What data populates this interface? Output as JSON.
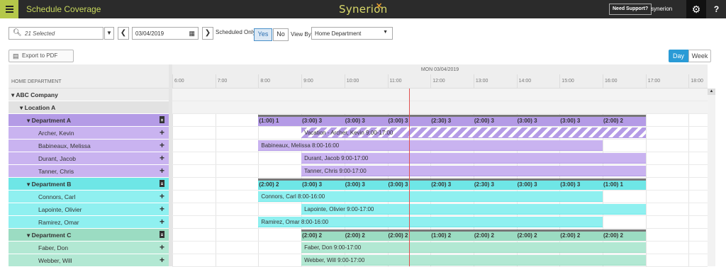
{
  "header": {
    "app_title": "Schedule Coverage",
    "logo": "Synerion",
    "support_label": "Need Support?",
    "user": "synerion",
    "help_label": "?"
  },
  "toolbar": {
    "employee_selection": "21 Selected",
    "date": "03/04/2019",
    "scheduled_only_label": "Scheduled Only",
    "yes_label": "Yes",
    "no_label": "No",
    "view_by_label": "View By",
    "view_by_value": "Home Department",
    "export_label": "Export to PDF",
    "day_label": "Day",
    "week_label": "Week"
  },
  "colors": {
    "dept_a": "#c9b3f0",
    "dept_a_header": "#b49be6",
    "dept_b": "#8ff0f0",
    "dept_b_header": "#6ee6e6",
    "dept_c": "#b2e8d3",
    "dept_c_header": "#9bdcc2",
    "now_line": "#e05050"
  },
  "grid": {
    "column_header": "HOME DEPARTMENT",
    "day_header": "MON 03/04/2019",
    "hours": [
      "6:00",
      "7:00",
      "8:00",
      "9:00",
      "10:00",
      "11:00",
      "12:00",
      "13:00",
      "14:00",
      "15:00",
      "16:00",
      "17:00",
      "18:00"
    ],
    "now_hour": 11.5
  },
  "rows": [
    {
      "type": "company",
      "label": "▾ ABC Company"
    },
    {
      "type": "location",
      "label": "▾ Location A"
    },
    {
      "type": "dept",
      "dept": "a",
      "label": "▾ Department A",
      "summary": [
        "(1:00) 1",
        "(3:00) 3",
        "(3:00) 3",
        "(3:00) 3",
        "(2:30) 3",
        "(2:00) 3",
        "(3:00) 3",
        "(3:00) 3",
        "(2:00) 2"
      ],
      "summary_range": [
        8,
        17
      ]
    },
    {
      "type": "emp",
      "dept": "a",
      "label": "Archer, Kevin",
      "bar": "Vacation - Archer, Kevin   9:00-17:00",
      "start": 9,
      "end": 17,
      "striped": true
    },
    {
      "type": "emp",
      "dept": "a",
      "label": "Babineaux, Melissa",
      "bar": "Babineaux, Melissa   8:00-16:00",
      "start": 8,
      "end": 16
    },
    {
      "type": "emp",
      "dept": "a",
      "label": "Durant, Jacob",
      "bar": "Durant, Jacob   9:00-17:00",
      "start": 9,
      "end": 17
    },
    {
      "type": "emp",
      "dept": "a",
      "label": "Tanner, Chris",
      "bar": "Tanner, Chris   9:00-17:00",
      "start": 9,
      "end": 17
    },
    {
      "type": "dept",
      "dept": "b",
      "label": "▾ Department B",
      "summary": [
        "(2:00) 2",
        "(3:00) 3",
        "(3:00) 3",
        "(3:00) 3",
        "(2:00) 3",
        "(2:30) 3",
        "(3:00) 3",
        "(3:00) 3",
        "(1:00) 1"
      ],
      "summary_range": [
        8,
        17
      ]
    },
    {
      "type": "emp",
      "dept": "b",
      "label": "Connors, Carl",
      "bar": "Connors, Carl   8:00-16:00",
      "start": 8,
      "end": 16
    },
    {
      "type": "emp",
      "dept": "b",
      "label": "Lapointe, Olivier",
      "bar": "Lapointe, Olivier   9:00-17:00",
      "start": 9,
      "end": 17
    },
    {
      "type": "emp",
      "dept": "b",
      "label": "Ramirez, Omar",
      "bar": "Ramirez, Omar   8:00-16:00",
      "start": 8,
      "end": 16
    },
    {
      "type": "dept",
      "dept": "c",
      "label": "▾ Department C",
      "summary": [
        "(2:00) 2",
        "(2:00) 2",
        "(2:00) 2",
        "(1:00) 2",
        "(2:00) 2",
        "(2:00) 2",
        "(2:00) 2",
        "(2:00) 2"
      ],
      "summary_range": [
        9,
        17
      ]
    },
    {
      "type": "emp",
      "dept": "c",
      "label": "Faber, Don",
      "bar": "Faber, Don   9:00-17:00",
      "start": 9,
      "end": 17
    },
    {
      "type": "emp",
      "dept": "c",
      "label": "Webber, Will",
      "bar": "Webber, Will   9:00-17:00",
      "start": 9,
      "end": 17
    }
  ]
}
